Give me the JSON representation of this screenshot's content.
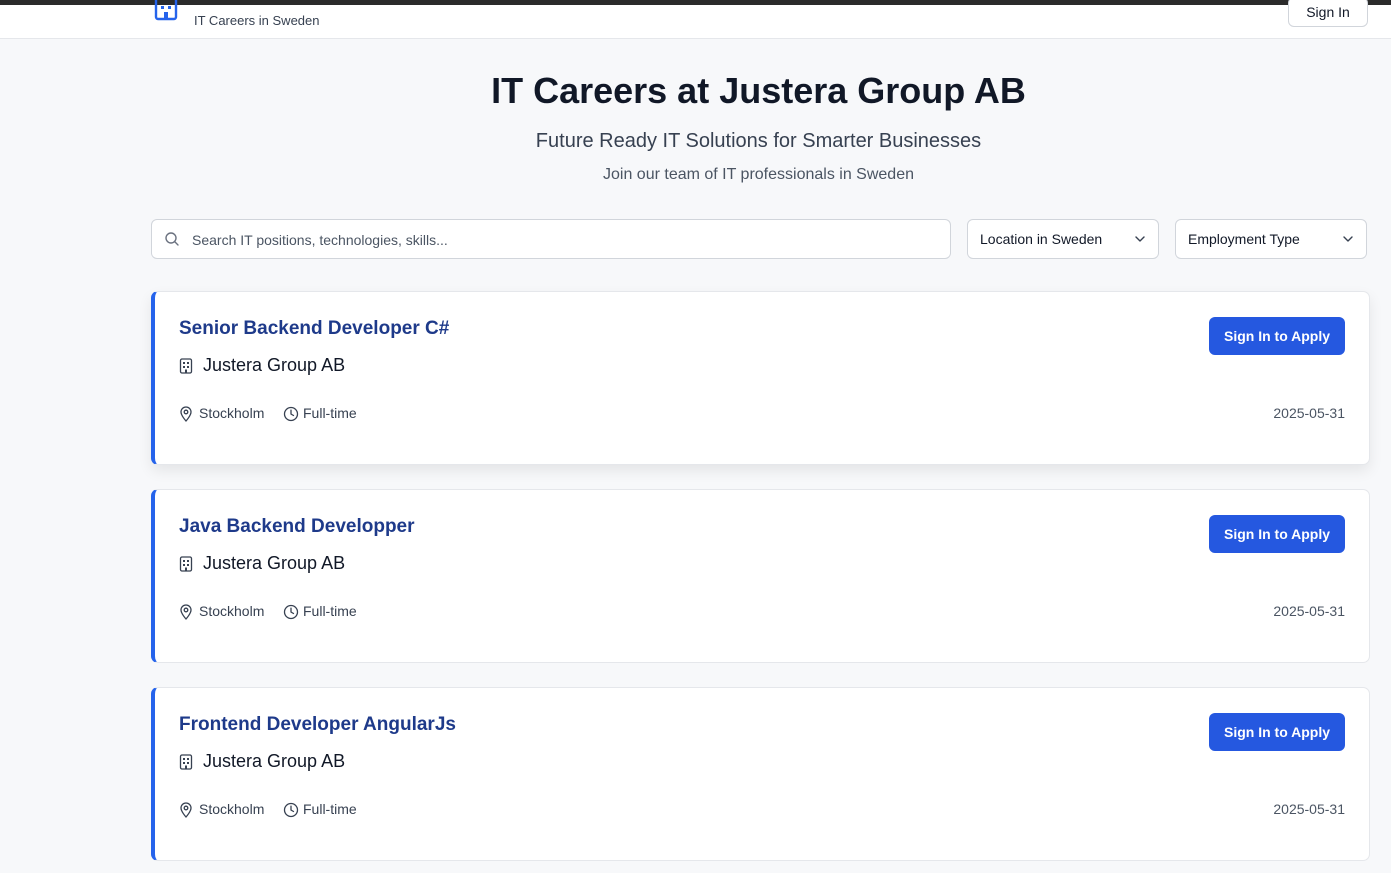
{
  "header": {
    "subtitle": "IT Careers in Sweden",
    "sign_in_label": "Sign In",
    "logo_icon": "building-icon"
  },
  "hero": {
    "title": "IT Careers at Justera Group AB",
    "subtitle": "Future Ready IT Solutions for Smarter Businesses",
    "tagline": "Join our team of IT professionals in Sweden"
  },
  "filters": {
    "search_placeholder": "Search IT positions, technologies, skills...",
    "location_label": "Location in Sweden",
    "employment_label": "Employment Type"
  },
  "jobs": [
    {
      "title": "Senior Backend Developer C#",
      "company": "Justera Group AB",
      "location": "Stockholm",
      "type": "Full-time",
      "date": "2025-05-31",
      "apply_label": "Sign In to Apply"
    },
    {
      "title": "Java Backend Developper",
      "company": "Justera Group AB",
      "location": "Stockholm",
      "type": "Full-time",
      "date": "2025-05-31",
      "apply_label": "Sign In to Apply"
    },
    {
      "title": "Frontend Developer AngularJs",
      "company": "Justera Group AB",
      "location": "Stockholm",
      "type": "Full-time",
      "date": "2025-05-31",
      "apply_label": "Sign In to Apply"
    }
  ],
  "colors": {
    "accent": "#2558e0",
    "title_blue": "#1e3a8a",
    "background": "#f7f8fa"
  }
}
